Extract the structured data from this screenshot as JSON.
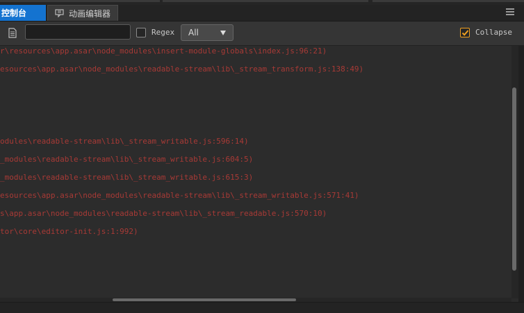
{
  "tabs": [
    {
      "label": "控制台",
      "active": true
    },
    {
      "label": "动画编辑器",
      "active": false
    }
  ],
  "toolbar": {
    "filter_value": "",
    "regex_label": "Regex",
    "regex_checked": false,
    "level_select": "All",
    "collapse_label": "Collapse",
    "collapse_checked": true
  },
  "log_lines": [
    "r\\resources\\app.asar\\node_modules\\insert-module-globals\\index.js:96:21)",
    "esources\\app.asar\\node_modules\\readable-stream\\lib\\_stream_transform.js:138:49)",
    "odules\\readable-stream\\lib\\_stream_writable.js:596:14)",
    "_modules\\readable-stream\\lib\\_stream_writable.js:604:5)",
    "_modules\\readable-stream\\lib\\_stream_writable.js:615:3)",
    "esources\\app.asar\\node_modules\\readable-stream\\lib\\_stream_writable.js:571:41)",
    "s\\app.asar\\node_modules\\readable-stream\\lib\\_stream_readable.js:570:10)",
    "tor\\core\\editor-init.js:1:992)"
  ],
  "colors": {
    "active_tab": "#1473d0",
    "error_text": "#a83a36",
    "checkbox_accent": "#f0a020"
  }
}
